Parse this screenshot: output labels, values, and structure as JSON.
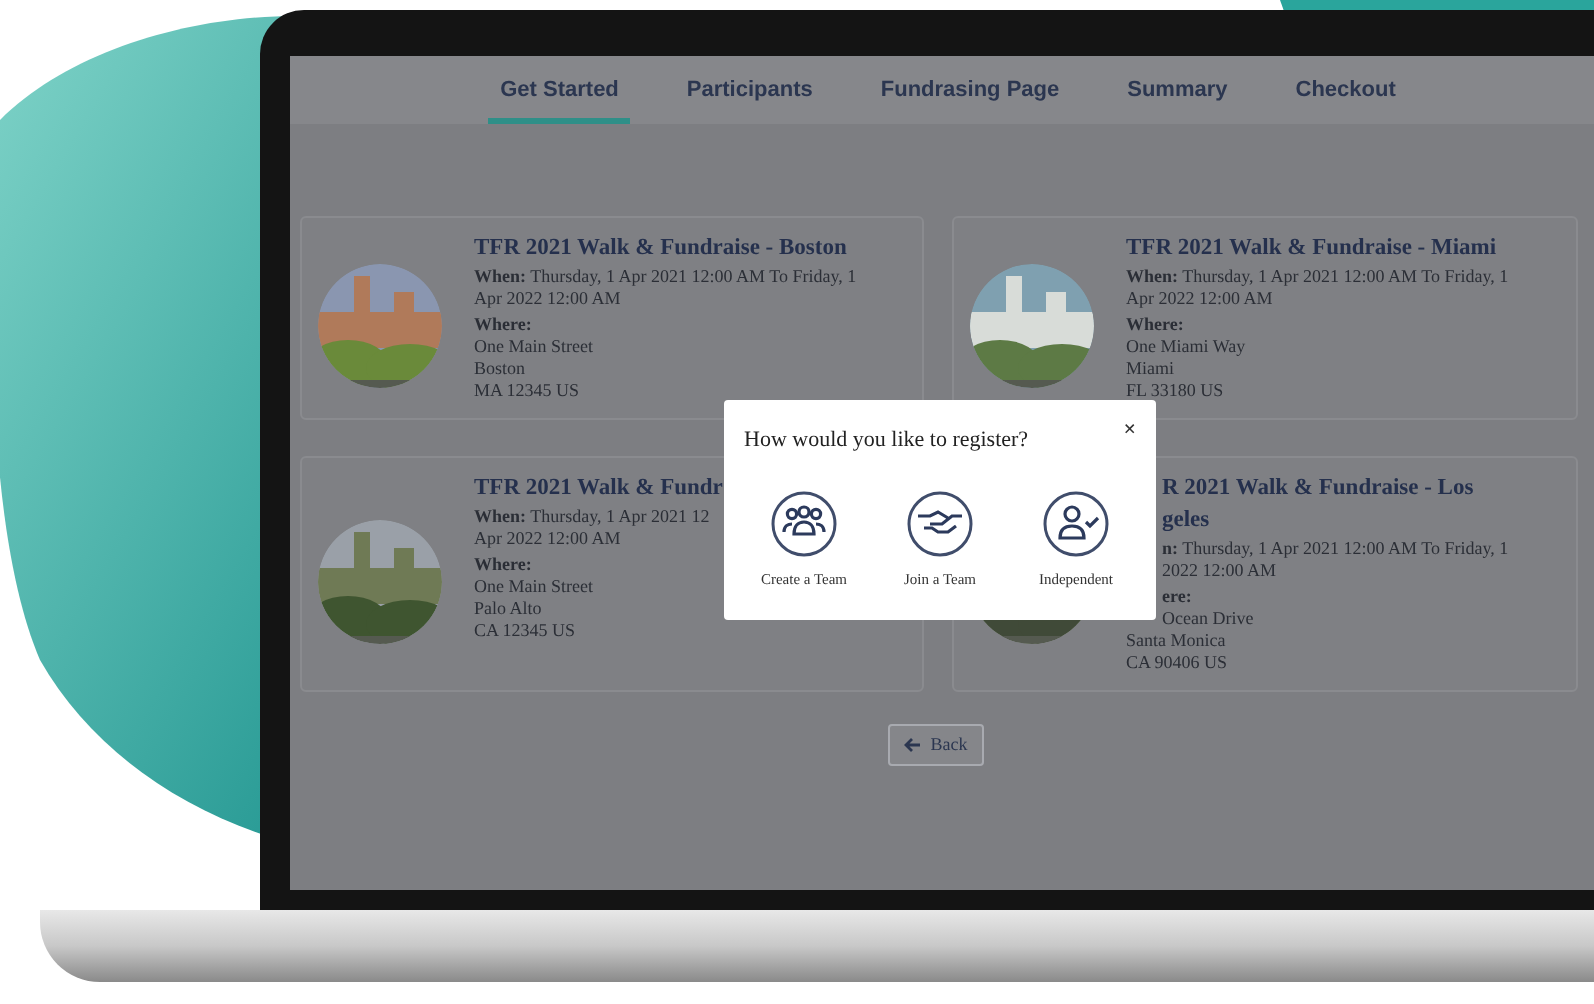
{
  "tabs": [
    {
      "label": "Get Started",
      "selected": true
    },
    {
      "label": "Participants",
      "selected": false
    },
    {
      "label": "Fundrasing Page",
      "selected": false
    },
    {
      "label": "Summary",
      "selected": false
    },
    {
      "label": "Checkout",
      "selected": false
    }
  ],
  "events": [
    {
      "lines": [
        {
          "kind": "title",
          "text": "TFR 2021 Walk & Fundraise - Boston"
        },
        {
          "kind": "when",
          "text": "**When:** Thursday, 1 Apr 2021 12:00 AM To Friday, 1"
        },
        {
          "kind": "text",
          "text": "Apr 2022 12:00 AM"
        },
        {
          "kind": "label",
          "text": "Where:"
        },
        {
          "kind": "text",
          "text": "One Main Street"
        },
        {
          "kind": "text",
          "text": "Boston"
        },
        {
          "kind": "text",
          "text": "MA 12345 US"
        }
      ]
    },
    {
      "lines": [
        {
          "kind": "title",
          "text": "TFR 2021 Walk & Fundraise - Miami"
        },
        {
          "kind": "when",
          "text": "**When:** Thursday, 1 Apr 2021 12:00 AM To Friday, 1"
        },
        {
          "kind": "text",
          "text": "Apr 2022 12:00 AM"
        },
        {
          "kind": "label",
          "text": "Where:"
        },
        {
          "kind": "text",
          "text": "One Miami Way"
        },
        {
          "kind": "text",
          "text": "Miami"
        },
        {
          "kind": "text",
          "text": "FL 33180 US"
        }
      ]
    },
    {
      "lines": [
        {
          "kind": "title",
          "text": "TFR 2021 Walk & Fundr"
        },
        {
          "kind": "when",
          "text": "**When:** Thursday, 1 Apr 2021 12"
        },
        {
          "kind": "text",
          "text": "Apr 2022 12:00 AM"
        },
        {
          "kind": "label",
          "text": "Where:"
        },
        {
          "kind": "text",
          "text": "One Main Street"
        },
        {
          "kind": "text",
          "text": "Palo Alto"
        },
        {
          "kind": "text",
          "text": "CA 12345 US"
        }
      ]
    },
    {
      "lines": [
        {
          "kind": "title",
          "text": "R 2021 Walk & Fundraise - Los"
        },
        {
          "kind": "title",
          "text": "geles"
        },
        {
          "kind": "when",
          "text": "**n:** Thursday, 1 Apr 2021 12:00 AM To Friday, 1"
        },
        {
          "kind": "text",
          "text": "2022 12:00 AM"
        },
        {
          "kind": "label",
          "text": "ere:"
        },
        {
          "kind": "text",
          "text": "Ocean Drive"
        },
        {
          "kind": "text",
          "text": "Santa Monica"
        },
        {
          "kind": "text",
          "text": "CA 90406 US"
        }
      ]
    }
  ],
  "back_button": {
    "label": "Back"
  },
  "dialog": {
    "title": "How would you like to register?",
    "close": "×",
    "options": [
      {
        "kind": "team",
        "label": "Create a Team"
      },
      {
        "kind": "join",
        "label": "Join a Team"
      },
      {
        "kind": "independent",
        "label": "Independent"
      }
    ]
  }
}
